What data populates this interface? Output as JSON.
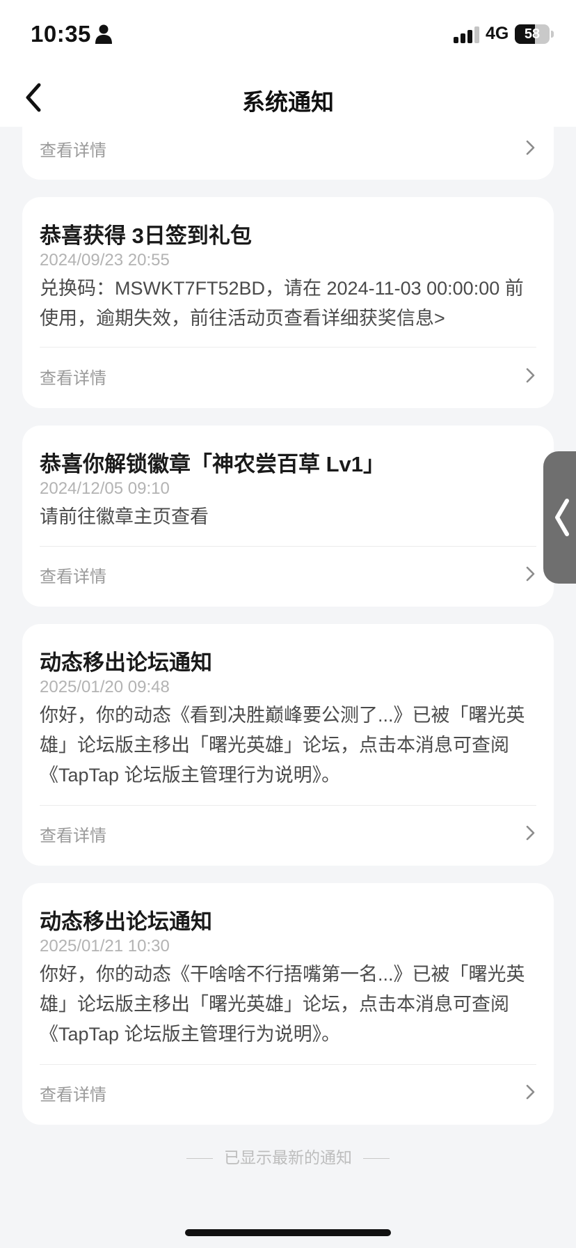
{
  "status_bar": {
    "time": "10:35",
    "network": "4G",
    "battery": "58",
    "battery_level": 0.58
  },
  "header": {
    "title": "系统通知"
  },
  "notifications": [
    {
      "detail_label": "查看详情"
    },
    {
      "title": "恭喜获得 3日签到礼包",
      "time": "2024/09/23 20:55",
      "body": "兑换码：MSWKT7FT52BD，请在 2024-11-03 00:00:00 前使用，逾期失效，前往活动页查看详细获奖信息>",
      "detail_label": "查看详情"
    },
    {
      "title": "恭喜你解锁徽章「神农尝百草 Lv1」",
      "time": "2024/12/05 09:10",
      "body": "请前往徽章主页查看",
      "detail_label": "查看详情"
    },
    {
      "title": "动态移出论坛通知",
      "time": "2025/01/20 09:48",
      "body": "你好，你的动态《看到决胜巅峰要公测了...》已被「曙光英雄」论坛版主移出「曙光英雄」论坛，点击本消息可查阅《TapTap 论坛版主管理行为说明》。",
      "detail_label": "查看详情"
    },
    {
      "title": "动态移出论坛通知",
      "time": "2025/01/21 10:30",
      "body": "你好，你的动态《干啥啥不行捂嘴第一名...》已被「曙光英雄」论坛版主移出「曙光英雄」论坛，点击本消息可查阅《TapTap 论坛版主管理行为说明》。",
      "detail_label": "查看详情"
    }
  ],
  "footer": {
    "note": "已显示最新的通知"
  }
}
